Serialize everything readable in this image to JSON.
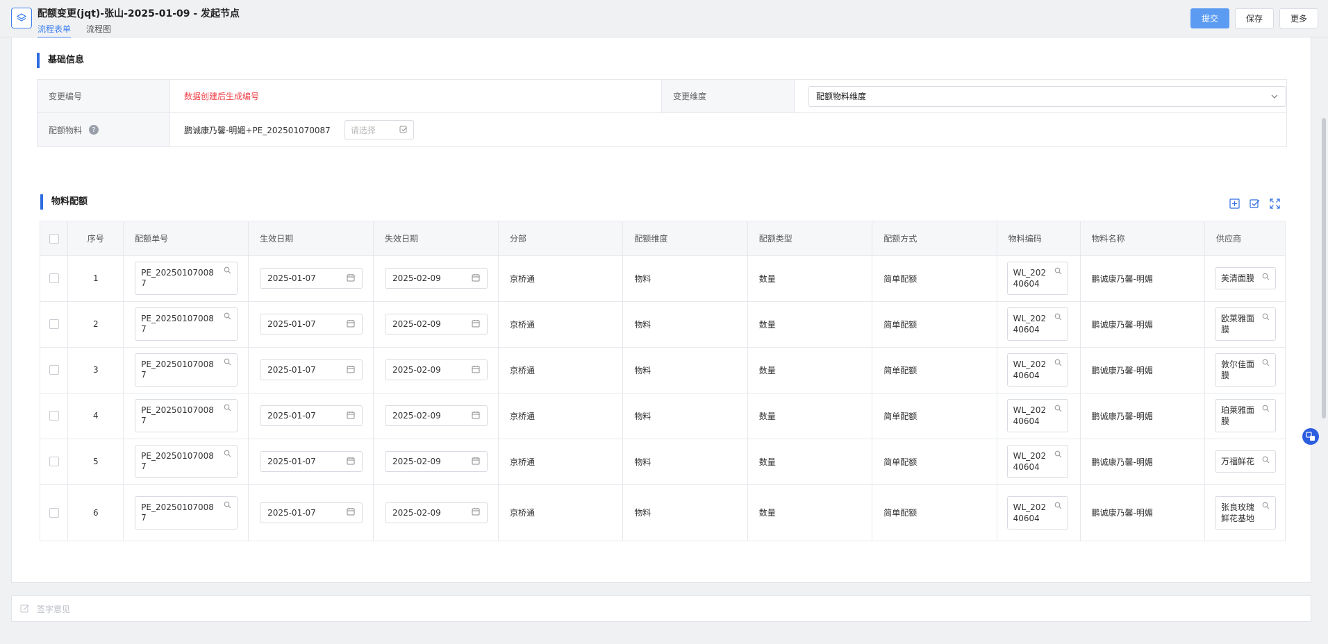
{
  "header": {
    "title": "配额变更(jqt)-张山-2025-01-09 - 发起节点",
    "tabs": [
      {
        "label": "流程表单"
      },
      {
        "label": "流程图"
      }
    ],
    "actions": {
      "submit": "提交",
      "save": "保存",
      "more": "更多"
    }
  },
  "basic_info": {
    "section_title": "基础信息",
    "change_no_label": "变更编号",
    "change_no_value": "数据创建后生成编号",
    "dimension_label": "变更维度",
    "dimension_value": "配额物料维度",
    "material_label": "配额物料",
    "material_value": "鹏诚康乃馨-明媚+PE_202501070087",
    "material_placeholder": "请选择"
  },
  "material_quota": {
    "section_title": "物料配额",
    "columns": [
      "序号",
      "配额单号",
      "生效日期",
      "失效日期",
      "分部",
      "配额维度",
      "配额类型",
      "配额方式",
      "物料编码",
      "物料名称",
      "供应商"
    ],
    "rows": [
      {
        "no": "1",
        "quota_no": "PE_202501070087",
        "start": "2025-01-07",
        "end": "2025-02-09",
        "branch": "京桥通",
        "dimension": "物料",
        "type": "数量",
        "method": "简单配额",
        "code": "WL_20240604",
        "name": "鹏诚康乃馨-明媚",
        "supplier": "芙清面膜"
      },
      {
        "no": "2",
        "quota_no": "PE_202501070087",
        "start": "2025-01-07",
        "end": "2025-02-09",
        "branch": "京桥通",
        "dimension": "物料",
        "type": "数量",
        "method": "简单配额",
        "code": "WL_20240604",
        "name": "鹏诚康乃馨-明媚",
        "supplier": "欧莱雅面膜"
      },
      {
        "no": "3",
        "quota_no": "PE_202501070087",
        "start": "2025-01-07",
        "end": "2025-02-09",
        "branch": "京桥通",
        "dimension": "物料",
        "type": "数量",
        "method": "简单配额",
        "code": "WL_20240604",
        "name": "鹏诚康乃馨-明媚",
        "supplier": "敦尔佳面膜"
      },
      {
        "no": "4",
        "quota_no": "PE_202501070087",
        "start": "2025-01-07",
        "end": "2025-02-09",
        "branch": "京桥通",
        "dimension": "物料",
        "type": "数量",
        "method": "简单配额",
        "code": "WL_20240604",
        "name": "鹏诚康乃馨-明媚",
        "supplier": "珀莱雅面膜"
      },
      {
        "no": "5",
        "quota_no": "PE_202501070087",
        "start": "2025-01-07",
        "end": "2025-02-09",
        "branch": "京桥通",
        "dimension": "物料",
        "type": "数量",
        "method": "简单配额",
        "code": "WL_20240604",
        "name": "鹏诚康乃馨-明媚",
        "supplier": "万福鲜花"
      },
      {
        "no": "6",
        "quota_no": "PE_202501070087",
        "start": "2025-01-07",
        "end": "2025-02-09",
        "branch": "京桥通",
        "dimension": "物料",
        "type": "数量",
        "method": "简单配额",
        "code": "WL_20240604",
        "name": "鹏诚康乃馨-明媚",
        "supplier": "张良玫瑰鲜花基地"
      }
    ]
  },
  "sign": {
    "placeholder": "签字意见"
  },
  "colors": {
    "accent": "#3d7ff0",
    "primary_button": "#5b9bf2",
    "section_bar": "#2d6de0",
    "error_text": "#f0424a"
  }
}
